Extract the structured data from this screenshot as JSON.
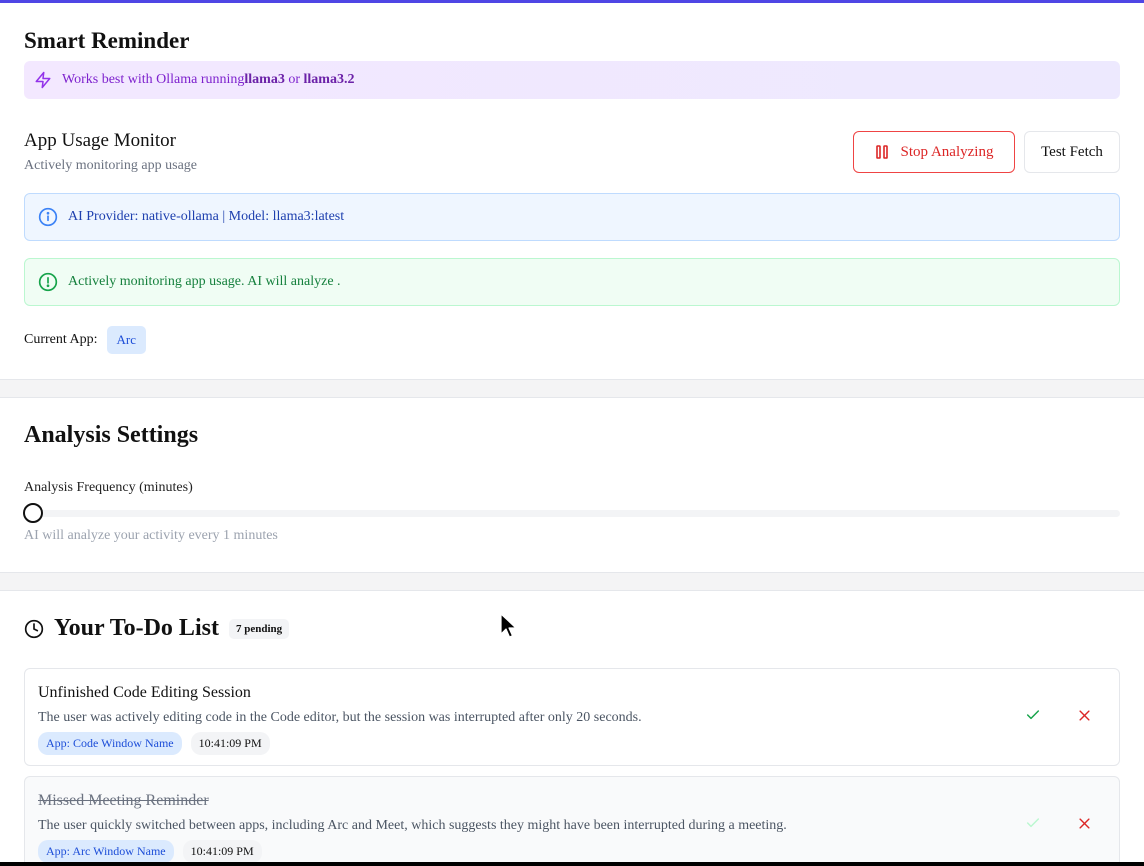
{
  "monitor": {
    "title": "Smart Reminder",
    "hint_prefix": "Works best with Ollama running ",
    "hint_model1": "llama3",
    "hint_or": " or ",
    "hint_model2": "llama3.2",
    "usage_title": "App Usage Monitor",
    "usage_subtitle": "Actively monitoring app usage",
    "stop_label": "Stop Analyzing",
    "test_label": "Test Fetch",
    "provider_info": "AI Provider: native-ollama | Model: llama3:latest",
    "status_message": "Actively monitoring app usage. AI will analyze .",
    "current_app_label": "Current App:",
    "current_app_value": "Arc"
  },
  "settings": {
    "title": "Analysis Settings",
    "frequency_label": "Analysis Frequency (minutes)",
    "frequency_value": 1,
    "frequency_help": "AI will analyze your activity every 1 minutes"
  },
  "todo": {
    "title": "Your To-Do List",
    "pending_badge": "7 pending",
    "tasks": [
      {
        "title": "Unfinished Code Editing Session",
        "description": "The user was actively editing code in the Code editor, but the session was interrupted after only 20 seconds.",
        "app_tag": "App: Code Window Name",
        "time": "10:41:09 PM",
        "completed": false
      },
      {
        "title": "Missed Meeting Reminder",
        "description": "The user quickly switched between apps, including Arc and Meet, which suggests they might have been interrupted during a meeting.",
        "app_tag": "App: Arc Window Name",
        "time": "10:41:09 PM",
        "completed": true
      }
    ]
  },
  "colors": {
    "accent": "#4f46e5",
    "danger": "#dc2626",
    "success": "#16a34a",
    "info": "#1e40af"
  },
  "icons": {
    "hint": "lightning-icon",
    "stop": "pause-icon",
    "info": "info-icon",
    "success": "alert-circle-icon",
    "todo": "clock-icon",
    "complete": "check-icon",
    "delete": "x-icon"
  }
}
